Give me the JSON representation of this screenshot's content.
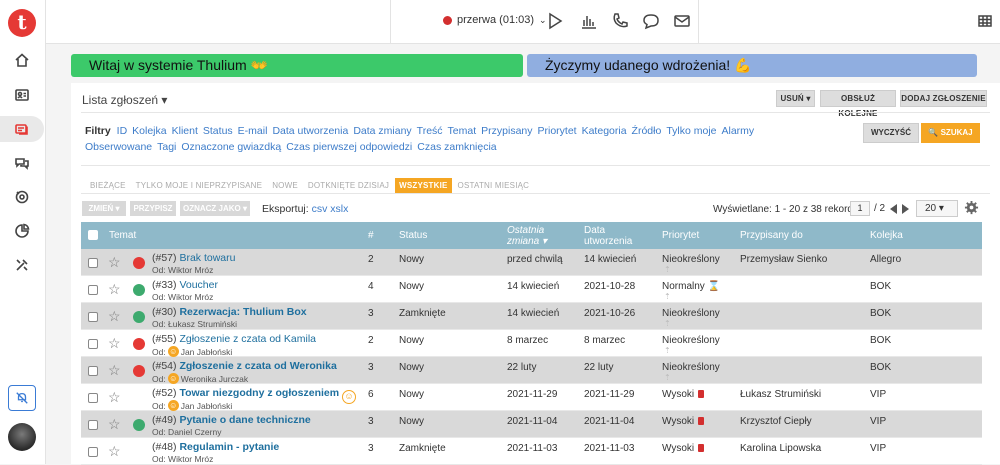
{
  "app": {
    "logo": "t"
  },
  "sidebar": {
    "items": [
      {
        "icon": "home-icon"
      },
      {
        "icon": "contacts-icon"
      },
      {
        "icon": "tickets-icon",
        "active": true
      },
      {
        "icon": "chat-icon"
      },
      {
        "icon": "campaign-icon"
      },
      {
        "icon": "reports-icon"
      },
      {
        "icon": "settings-tools-icon"
      }
    ]
  },
  "topbar": {
    "status_label": "przerwa (01:03)",
    "status_color": "#d32f2f"
  },
  "banners": {
    "welcome": "Witaj w systemie Thulium 👐",
    "wish": "Życzymy udanego wdrożenia! 💪"
  },
  "panel": {
    "title": "Lista zgłoszeń ▾",
    "buttons": {
      "delete": "USUŃ ▾",
      "handle_next": "OBSŁUŻ KOLEJNE",
      "add": "DODAJ ZGŁOSZENIE"
    }
  },
  "filters": {
    "label": "Filtry",
    "items": [
      "ID",
      "Kolejka",
      "Klient",
      "Status",
      "E-mail",
      "Data utworzenia",
      "Data zmiany",
      "Treść",
      "Temat",
      "Przypisany",
      "Priorytet",
      "Kategoria",
      "Źródło",
      "Tylko moje",
      "Alarmy",
      "Obserwowane",
      "Tagi",
      "Oznaczone gwiazdką",
      "Czas pierwszej odpowiedzi",
      "Czas zamknięcia"
    ],
    "clear": "WYCZYŚĆ",
    "search": "🔍 SZUKAJ"
  },
  "tabs": [
    "BIEŻĄCE",
    "TYLKO MOJE I NIEPRZYPISANE",
    "NOWE",
    "DOTKNIĘTE DZISIAJ",
    "WSZYSTKIE",
    "OSTATNI MIESIĄC"
  ],
  "actions": {
    "change": "ZMIEŃ ▾",
    "assign": "PRZYPISZ",
    "mark": "OZNACZ JAKO ▾"
  },
  "export": {
    "label": "Eksportuj:",
    "csv": "csv",
    "xslx": "xslx"
  },
  "pagination": {
    "records": "Wyświetlane: 1 - 20 z 38 rekordów",
    "page": "1",
    "of": "/ 2",
    "per_page": "20 ▾"
  },
  "columns": {
    "subject": "Temat",
    "num": "#",
    "status": "Status",
    "last_change": "Ostatnia zmiana ▾",
    "created": "Data utworzenia",
    "priority": "Priorytet",
    "assigned": "Przypisany do",
    "queue": "Kolejka"
  },
  "rows": [
    {
      "id": "(#57)",
      "title": "Brak towaru",
      "bold": false,
      "from": "Od: Wiktor Mróz",
      "smile": false,
      "dot": "#e53935",
      "num": "2",
      "status": "Nowy",
      "last": "przed chwilą",
      "created": "14 kwiecień",
      "priority": "Nieokreślony",
      "pflag": false,
      "assigned": "Przemysław Sienko",
      "queue": "Allegro",
      "gray": true
    },
    {
      "id": "(#33)",
      "title": "Voucher",
      "bold": false,
      "from": "Od: Wiktor Mróz",
      "smile": false,
      "dot": "#3daa6e",
      "num": "4",
      "status": "Nowy",
      "last": "14 kwiecień",
      "created": "2021-10-28",
      "priority": "Normalny ⌛",
      "pflag": false,
      "assigned": "",
      "queue": "BOK",
      "gray": false
    },
    {
      "id": "(#30)",
      "title": "Rezerwacja: Thulium Box",
      "bold": true,
      "from": "Od: Łukasz Strumiński",
      "smile": false,
      "dot": "#3daa6e",
      "num": "3",
      "status": "Zamknięte",
      "last": "14 kwiecień",
      "created": "2021-10-26",
      "priority": "Nieokreślony",
      "pflag": false,
      "assigned": "",
      "queue": "BOK",
      "gray": true
    },
    {
      "id": "(#55)",
      "title": "Zgłoszenie z czata od Kamila",
      "bold": false,
      "from": "Jan Jabłoński",
      "smile": true,
      "dot": "#e53935",
      "num": "2",
      "status": "Nowy",
      "last": "8 marzec",
      "created": "8 marzec",
      "priority": "Nieokreślony",
      "pflag": false,
      "assigned": "",
      "queue": "BOK",
      "gray": false
    },
    {
      "id": "(#54)",
      "title": "Zgłoszenie z czata od Weronika",
      "bold": true,
      "from": "Weronika Jurczak",
      "smile": true,
      "dot": "#e53935",
      "num": "3",
      "status": "Nowy",
      "last": "22 luty",
      "created": "22 luty",
      "priority": "Nieokreślony",
      "pflag": false,
      "assigned": "",
      "queue": "BOK",
      "gray": true
    },
    {
      "id": "(#52)",
      "title": "Towar niezgodny z ogłoszeniem",
      "bold": true,
      "from": "Jan Jabłoński",
      "smile": true,
      "dot": "",
      "num": "6",
      "status": "Nowy",
      "last": "2021-11-29",
      "created": "2021-11-29",
      "priority": "Wysoki",
      "pflag": true,
      "assigned": "Łukasz Strumiński",
      "queue": "VIP",
      "gray": false,
      "bigsmile": true
    },
    {
      "id": "(#49)",
      "title": "Pytanie o dane techniczne",
      "bold": true,
      "from": "Od: Daniel Czerny",
      "smile": false,
      "dot": "#3daa6e",
      "num": "3",
      "status": "Nowy",
      "last": "2021-11-04",
      "created": "2021-11-04",
      "priority": "Wysoki",
      "pflag": true,
      "assigned": "Krzysztof Ciepły",
      "queue": "VIP",
      "gray": true
    },
    {
      "id": "(#48)",
      "title": "Regulamin - pytanie",
      "bold": true,
      "from": "Od: Wiktor Mróz",
      "smile": false,
      "dot": "",
      "num": "3",
      "status": "Zamknięte",
      "last": "2021-11-03",
      "created": "2021-11-03",
      "priority": "Wysoki",
      "pflag": true,
      "assigned": "Karolina Lipowska",
      "queue": "VIP",
      "gray": false
    }
  ]
}
